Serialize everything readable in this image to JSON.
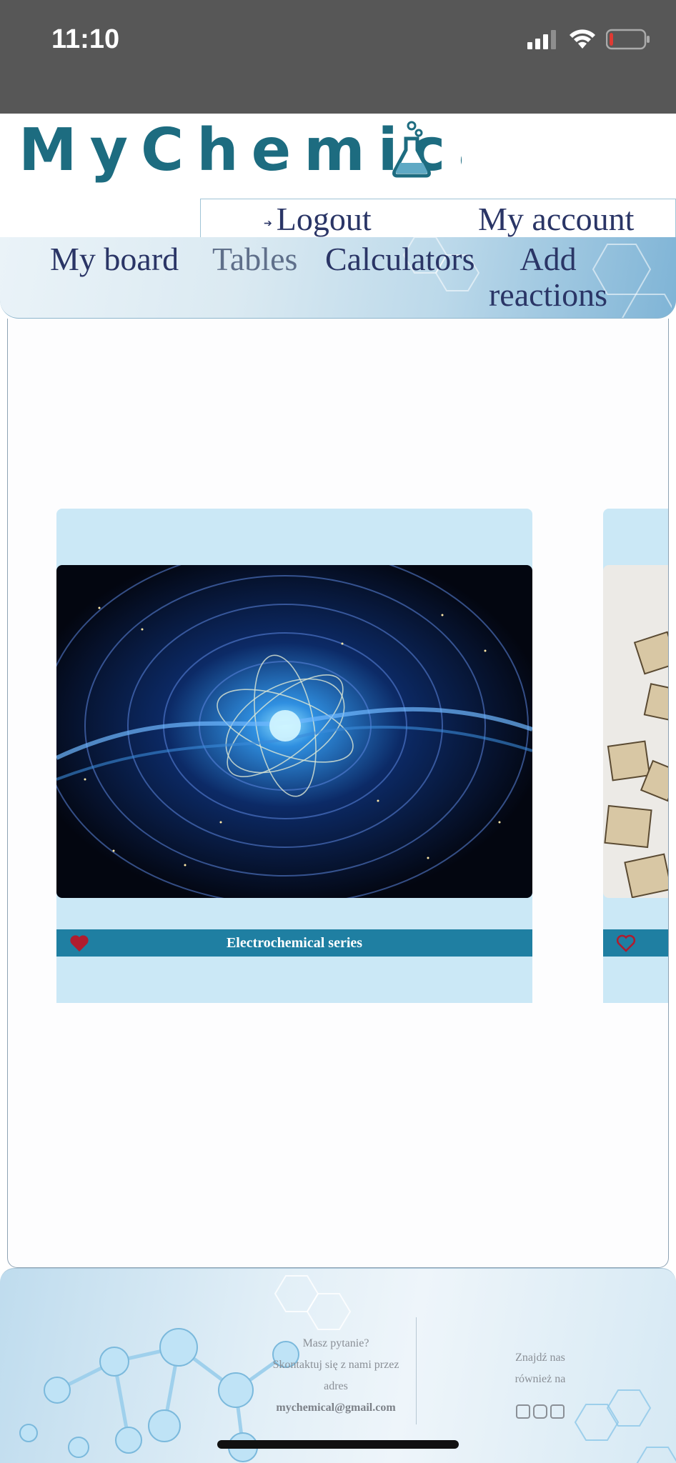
{
  "status_bar": {
    "time": "11:10",
    "battery_level": 0.1
  },
  "header": {
    "logo_text": "MyChemical",
    "logout_label": "Logout",
    "account_label": "My account"
  },
  "nav": {
    "items": [
      {
        "label": "My board"
      },
      {
        "label": "Tables",
        "active": true
      },
      {
        "label": "Calculators"
      },
      {
        "label": "Add reactions"
      }
    ]
  },
  "cards": [
    {
      "title": "Electrochemical series",
      "favorite": true
    },
    {
      "title": "",
      "favorite": false
    }
  ],
  "footer": {
    "question": "Masz pytanie?",
    "contact_line": "Skontaktuj się z nami przez",
    "contact_line2": "adres",
    "email": "mychemical@gmail.com",
    "find_us": "Znajdź nas",
    "find_us2": "również na"
  },
  "colors": {
    "brand_teal": "#1d6c80",
    "card_bar": "#1f7fa2",
    "heart": "#b01c2e"
  }
}
